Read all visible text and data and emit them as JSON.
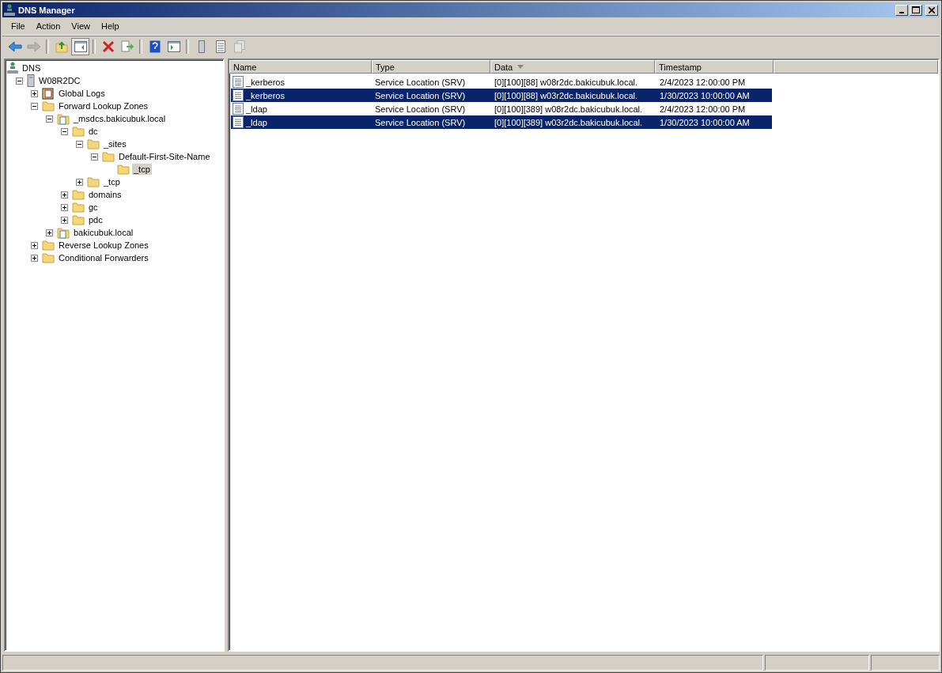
{
  "window": {
    "title": "DNS Manager"
  },
  "menu": [
    "File",
    "Action",
    "View",
    "Help"
  ],
  "toolbar": [
    {
      "kind": "back",
      "disabled": false,
      "pressed": false
    },
    {
      "kind": "forward",
      "disabled": true,
      "pressed": false
    },
    {
      "kind": "separator"
    },
    {
      "kind": "up",
      "disabled": false,
      "pressed": false
    },
    {
      "kind": "tree",
      "disabled": false,
      "pressed": true
    },
    {
      "kind": "separator"
    },
    {
      "kind": "delete",
      "disabled": false,
      "pressed": false
    },
    {
      "kind": "export",
      "disabled": false,
      "pressed": false
    },
    {
      "kind": "separator"
    },
    {
      "kind": "help",
      "disabled": false,
      "pressed": false
    },
    {
      "kind": "pane",
      "disabled": false,
      "pressed": false
    },
    {
      "kind": "separator"
    },
    {
      "kind": "server",
      "disabled": false,
      "pressed": false
    },
    {
      "kind": "list",
      "disabled": false,
      "pressed": false
    },
    {
      "kind": "copy",
      "disabled": true,
      "pressed": false
    }
  ],
  "tree": [
    {
      "label": "DNS",
      "kind": "dns",
      "selected": false,
      "children": [
        {
          "label": "W08R2DC",
          "kind": "server",
          "expanded": true,
          "selected": false,
          "children": [
            {
              "label": "Global Logs",
              "kind": "log",
              "expanded": false,
              "selected": false
            },
            {
              "label": "Forward Lookup Zones",
              "kind": "folder",
              "expanded": true,
              "selected": false,
              "children": [
                {
                  "label": "_msdcs.bakicubuk.local",
                  "kind": "zone",
                  "expanded": true,
                  "selected": false,
                  "children": [
                    {
                      "label": "dc",
                      "kind": "folder",
                      "expanded": true,
                      "selected": false,
                      "children": [
                        {
                          "label": "_sites",
                          "kind": "folder",
                          "expanded": true,
                          "selected": false,
                          "children": [
                            {
                              "label": "Default-First-Site-Name",
                              "kind": "folder",
                              "expanded": true,
                              "selected": false,
                              "children": [
                                {
                                  "label": "_tcp",
                                  "kind": "folder",
                                  "selected": true
                                }
                              ]
                            }
                          ]
                        },
                        {
                          "label": "_tcp",
                          "kind": "folder",
                          "expanded": false,
                          "selected": false
                        }
                      ]
                    },
                    {
                      "label": "domains",
                      "kind": "folder",
                      "expanded": false,
                      "selected": false
                    },
                    {
                      "label": "gc",
                      "kind": "folder",
                      "expanded": false,
                      "selected": false
                    },
                    {
                      "label": "pdc",
                      "kind": "folder",
                      "expanded": false,
                      "selected": false
                    }
                  ]
                },
                {
                  "label": "bakicubuk.local",
                  "kind": "zone",
                  "expanded": false,
                  "selected": false
                }
              ]
            },
            {
              "label": "Reverse Lookup Zones",
              "kind": "folder",
              "expanded": false,
              "selected": false
            },
            {
              "label": "Conditional Forwarders",
              "kind": "folder",
              "expanded": false,
              "selected": false
            }
          ]
        }
      ]
    }
  ],
  "table": {
    "columns": [
      {
        "label": "Name",
        "sorted": false
      },
      {
        "label": "Type",
        "sorted": false
      },
      {
        "label": "Data",
        "sorted": true
      },
      {
        "label": "Timestamp",
        "sorted": false
      }
    ],
    "rows": [
      {
        "cells": [
          "_kerberos",
          "Service Location (SRV)",
          "[0][100][88] w08r2dc.bakicubuk.local.",
          "2/4/2023 12:00:00 PM"
        ],
        "selected": false
      },
      {
        "cells": [
          "_kerberos",
          "Service Location (SRV)",
          "[0][100][88] w03r2dc.bakicubuk.local.",
          "1/30/2023 10:00:00 AM"
        ],
        "selected": true
      },
      {
        "cells": [
          "_ldap",
          "Service Location (SRV)",
          "[0][100][389] w08r2dc.bakicubuk.local.",
          "2/4/2023 12:00:00 PM"
        ],
        "selected": false
      },
      {
        "cells": [
          "_ldap",
          "Service Location (SRV)",
          "[0][100][389] w03r2dc.bakicubuk.local.",
          "1/30/2023 10:00:00 AM"
        ],
        "selected": true
      }
    ]
  }
}
